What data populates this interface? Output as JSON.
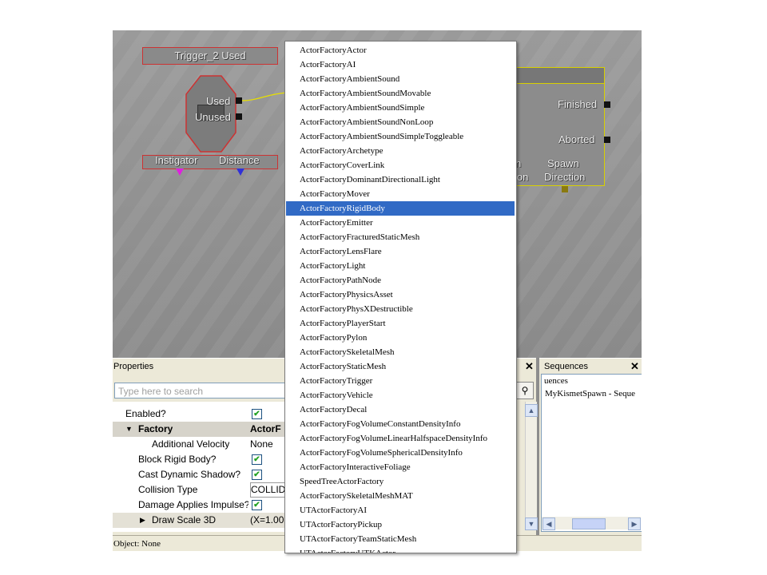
{
  "canvas": {
    "trigger_node_title": "Trigger_2 Used",
    "trigger_outputs": [
      "Used",
      "Unused"
    ],
    "trigger_variables": [
      "Instigator",
      "Distance"
    ],
    "action_outputs": [
      "Finished",
      "Aborted"
    ],
    "action_var_partial_1": "n",
    "action_var_partial_2": "ion",
    "action_var_label_1": "Spawn",
    "action_var_label_2": "Direction"
  },
  "properties": {
    "title": "Properties",
    "search_placeholder": "Type here to search",
    "rows": [
      {
        "name": "Enabled?",
        "type": "checkbox",
        "checked": true,
        "indent": 1
      },
      {
        "name": "Factory",
        "value": "ActorF...",
        "type": "category",
        "indent": 0
      },
      {
        "name": "Additional Velocity",
        "value": "None",
        "type": "text",
        "indent": 3
      },
      {
        "name": "Block Rigid Body?",
        "type": "checkbox",
        "checked": true,
        "indent": 2
      },
      {
        "name": "Cast Dynamic Shadow?",
        "type": "checkbox",
        "checked": true,
        "indent": 2
      },
      {
        "name": "Collision Type",
        "value": "COLLID",
        "type": "input",
        "indent": 2
      },
      {
        "name": "Damage Applies Impulse?",
        "type": "checkbox",
        "checked": true,
        "indent": 2
      },
      {
        "name": "Draw Scale 3D",
        "value": "(X=1.00",
        "type": "expandable",
        "indent": 2
      }
    ],
    "factory_value": "ActorF",
    "collision_value": "COLLID",
    "draw_scale_value": "(X=1.00"
  },
  "sequences": {
    "title": "Sequences",
    "root_partial": "uences",
    "item": "MyKismetSpawn - Seque"
  },
  "status": {
    "text": "Object: None"
  },
  "menu": {
    "selected_index": 11,
    "items": [
      "ActorFactoryActor",
      "ActorFactoryAI",
      "ActorFactoryAmbientSound",
      "ActorFactoryAmbientSoundMovable",
      "ActorFactoryAmbientSoundSimple",
      "ActorFactoryAmbientSoundNonLoop",
      "ActorFactoryAmbientSoundSimpleToggleable",
      "ActorFactoryArchetype",
      "ActorFactoryCoverLink",
      "ActorFactoryDominantDirectionalLight",
      "ActorFactoryMover",
      "ActorFactoryRigidBody",
      "ActorFactoryEmitter",
      "ActorFactoryFracturedStaticMesh",
      "ActorFactoryLensFlare",
      "ActorFactoryLight",
      "ActorFactoryPathNode",
      "ActorFactoryPhysicsAsset",
      "ActorFactoryPhysXDestructible",
      "ActorFactoryPlayerStart",
      "ActorFactoryPylon",
      "ActorFactorySkeletalMesh",
      "ActorFactoryStaticMesh",
      "ActorFactoryTrigger",
      "ActorFactoryVehicle",
      "ActorFactoryDecal",
      "ActorFactoryFogVolumeConstantDensityInfo",
      "ActorFactoryFogVolumeLinearHalfspaceDensityInfo",
      "ActorFactoryFogVolumeSphericalDensityInfo",
      "ActorFactoryInteractiveFoliage",
      "SpeedTreeActorFactory",
      "ActorFactorySkeletalMeshMAT",
      "UTActorFactoryAI",
      "UTActorFactoryPickup",
      "UTActorFactoryTeamStaticMesh",
      "UTActorFactoryUTKActor"
    ]
  },
  "colors": {
    "selection": "#316ac5",
    "node_border_red": "#cc3333",
    "node_border_yellow": "#d8d000",
    "panel_bg": "#ece9d8"
  }
}
